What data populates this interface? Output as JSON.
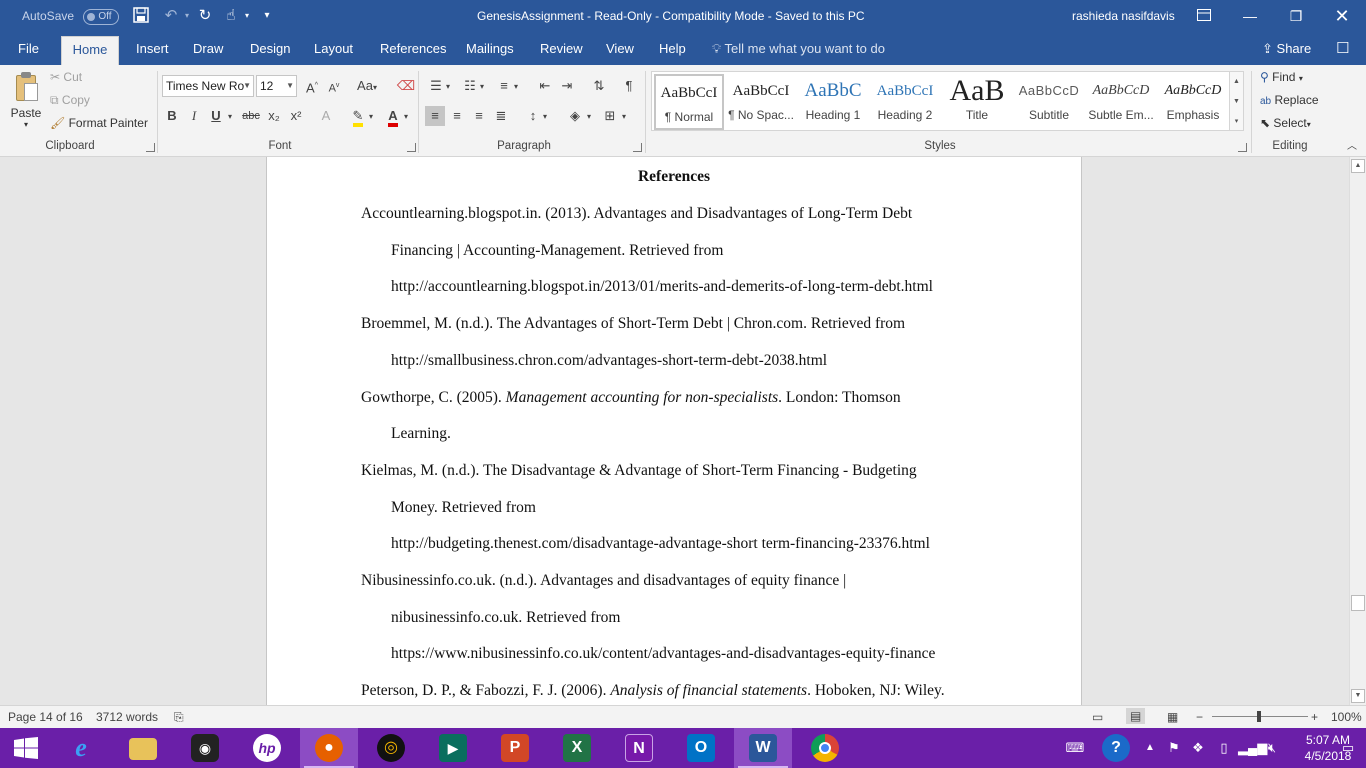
{
  "titlebar": {
    "autosave_label": "AutoSave",
    "autosave_state": "Off",
    "document_title": "GenesisAssignment  -  Read-Only  -  Compatibility Mode  -  Saved to this PC",
    "user_name": "rashieda nasifdavis"
  },
  "tabs": [
    "File",
    "Home",
    "Insert",
    "Draw",
    "Design",
    "Layout",
    "References",
    "Mailings",
    "Review",
    "View",
    "Help"
  ],
  "tell_me_placeholder": "Tell me what you want to do",
  "share_label": "Share",
  "ribbon": {
    "clipboard": {
      "paste": "Paste",
      "cut": "Cut",
      "copy": "Copy",
      "format_painter": "Format Painter",
      "label": "Clipboard"
    },
    "font": {
      "font_name": "Times New Ro",
      "font_size": "12",
      "label": "Font",
      "bold": "B",
      "italic": "I",
      "underline": "U",
      "strike": "abc",
      "subscript": "x₂",
      "superscript": "x²",
      "case": "Aa"
    },
    "paragraph": {
      "label": "Paragraph"
    },
    "styles": {
      "label": "Styles",
      "items": [
        {
          "preview": "AaBbCcI",
          "name": "¶ Normal"
        },
        {
          "preview": "AaBbCcI",
          "name": "¶ No Spac..."
        },
        {
          "preview": "AaBbC",
          "name": "Heading 1"
        },
        {
          "preview": "AaBbCcI",
          "name": "Heading 2"
        },
        {
          "preview": "AaB",
          "name": "Title"
        },
        {
          "preview": "AaBbCcD",
          "name": "Subtitle"
        },
        {
          "preview": "AaBbCcD",
          "name": "Subtle Em..."
        },
        {
          "preview": "AaBbCcD",
          "name": "Emphasis"
        }
      ]
    },
    "editing": {
      "label": "Editing",
      "find": "Find",
      "replace": "Replace",
      "select": "Select"
    }
  },
  "document": {
    "heading": "References",
    "lines": [
      {
        "text": "Accountlearning.blogspot.in. (2013). Advantages and Disadvantages of Long-Term Debt"
      },
      {
        "text": "Financing | Accounting-Management. Retrieved from"
      },
      {
        "text": "http://accountlearning.blogspot.in/2013/01/merits-and-demerits-of-long-term-debt.html"
      },
      {
        "text": "Broemmel, M. (n.d.). The Advantages of Short-Term Debt | Chron.com. Retrieved from"
      },
      {
        "text": "http://smallbusiness.chron.com/advantages-short-term-debt-2038.html"
      },
      {
        "pre": "Gowthorpe, C. (2005). ",
        "ital": "Management accounting for non-specialists",
        "post": ". London: Thomson"
      },
      {
        "text": "Learning."
      },
      {
        "text": "Kielmas, M. (n.d.). The Disadvantage & Advantage of Short-Term Financing - Budgeting"
      },
      {
        "text": "Money. Retrieved from"
      },
      {
        "text": "http://budgeting.thenest.com/disadvantage-advantage-short term-financing-23376.html"
      },
      {
        "text": "Nibusinessinfo.co.uk. (n.d.). Advantages and disadvantages of equity finance |"
      },
      {
        "text": "nibusinessinfo.co.uk. Retrieved from"
      },
      {
        "text": "https://www.nibusinessinfo.co.uk/content/advantages-and-disadvantages-equity-finance"
      },
      {
        "pre": "Peterson, D. P., & Fabozzi, F. J. (2006). ",
        "ital": "Analysis of financial statements",
        "post": ". Hoboken, NJ: Wiley."
      }
    ]
  },
  "statusbar": {
    "page": "Page 14 of 16",
    "words": "3712 words",
    "zoom": "100%"
  },
  "taskbar": {
    "time": "5:07 AM",
    "date": "4/5/2018"
  }
}
